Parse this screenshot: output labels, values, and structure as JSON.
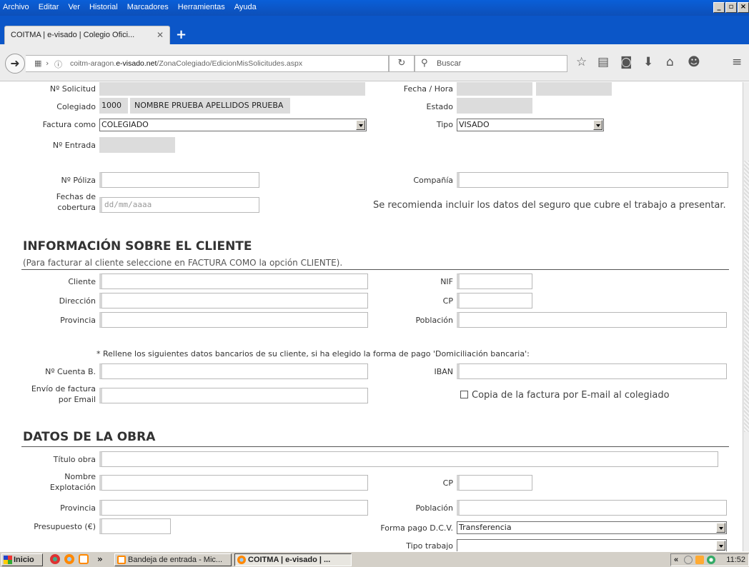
{
  "browser": {
    "menu": [
      "Archivo",
      "Editar",
      "Ver",
      "Historial",
      "Marcadores",
      "Herramientas",
      "Ayuda"
    ],
    "tab_title": "COITMA | e-visado | Colegio Ofici...",
    "url_prefix": "coitm-aragon.",
    "url_domain": "e-visado.net",
    "url_path": "/ZonaColegiado/EdicionMisSolicitudes.aspx",
    "search_placeholder": "Buscar"
  },
  "form": {
    "labels": {
      "solicitud": "Nº Solicitud",
      "colegiado": "Colegiado",
      "factura_como": "Factura como",
      "entrada": "Nº Entrada",
      "fecha_hora": "Fecha / Hora",
      "estado": "Estado",
      "tipo": "Tipo",
      "poliza": "Nº Póliza",
      "fechas_cobertura_1": "Fechas de",
      "fechas_cobertura_2": "cobertura",
      "compania": "Compañía"
    },
    "colegiado_num": "1000",
    "colegiado_nombre": "NOMBRE PRUEBA APELLIDOS PRUEBA",
    "factura_como_value": "COLEGIADO",
    "tipo_value": "VISADO",
    "fechas_placeholder": "dd/mm/aaaa",
    "seguro_note": "Se recomienda incluir los datos del seguro que cubre el trabajo a presentar."
  },
  "cliente": {
    "title": "INFORMACIÓN SOBRE EL CLIENTE",
    "subtitle": "(Para facturar al cliente seleccione en FACTURA COMO la opción CLIENTE).",
    "labels": {
      "cliente": "Cliente",
      "direccion": "Dirección",
      "provincia": "Provincia",
      "nif": "NIF",
      "cp": "CP",
      "poblacion": "Población",
      "cuenta": "Nº Cuenta B.",
      "iban": "IBAN",
      "envio_1": "Envío de factura",
      "envio_2": "por Email"
    },
    "bank_note": "* Rellene los siguientes datos bancarios de su cliente, si ha elegido la forma de pago 'Domiciliación bancaria':",
    "copia_label": "Copia de la factura por E-mail al colegiado"
  },
  "obra": {
    "title": "DATOS DE LA OBRA",
    "labels": {
      "titulo": "Título obra",
      "nombre_1": "Nombre",
      "nombre_2": "Explotación",
      "provincia": "Provincia",
      "presupuesto": "Presupuesto (€)",
      "cp": "CP",
      "poblacion": "Población",
      "forma_pago": "Forma pago D.C.V.",
      "tipo_trabajo": "Tipo trabajo"
    },
    "forma_pago_value": "Transferencia",
    "tipo_trabajo_value": ""
  },
  "taskbar": {
    "start": "Inicio",
    "chevron": "»",
    "items": [
      "Bandeja de entrada - Mic...",
      "COITMA | e-visado | ..."
    ],
    "tray_chevron": "«",
    "clock": "11:52"
  }
}
